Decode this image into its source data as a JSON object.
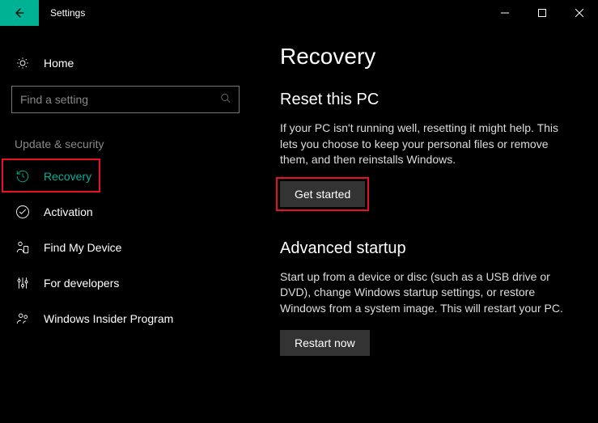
{
  "titlebar": {
    "title": "Settings"
  },
  "sidebar": {
    "home_label": "Home",
    "search_placeholder": "Find a setting",
    "section_label": "Update & security",
    "items": [
      {
        "label": "Recovery"
      },
      {
        "label": "Activation"
      },
      {
        "label": "Find My Device"
      },
      {
        "label": "For developers"
      },
      {
        "label": "Windows Insider Program"
      }
    ]
  },
  "main": {
    "page_title": "Recovery",
    "reset": {
      "heading": "Reset this PC",
      "body": "If your PC isn't running well, resetting it might help. This lets you choose to keep your personal files or remove them, and then reinstalls Windows.",
      "button": "Get started"
    },
    "advanced": {
      "heading": "Advanced startup",
      "body": "Start up from a device or disc (such as a USB drive or DVD), change Windows startup settings, or restore Windows from a system image. This will restart your PC.",
      "button": "Restart now"
    }
  }
}
